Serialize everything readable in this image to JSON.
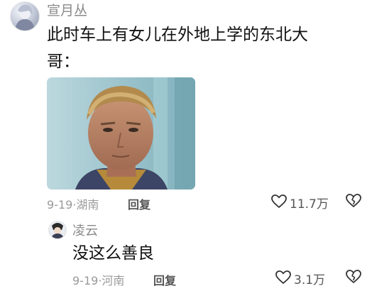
{
  "comments": [
    {
      "username": "宣月丛",
      "text_line1": "此时车上有女儿在外地上学的东北大",
      "text_line2": "哥：",
      "date": "9-19",
      "sep": "·",
      "location": "湖南",
      "reply_label": "回复",
      "like_count": "11.7万",
      "image_icon": "photo-portrait"
    },
    {
      "username": "凌云",
      "text": "没这么善良",
      "date": "9-19",
      "sep": "·",
      "location": "河南",
      "reply_label": "回复",
      "like_count": "3.1万"
    }
  ],
  "icons": {
    "like": "heart-outline-icon",
    "dislike": "broken-heart-icon"
  },
  "colors": {
    "text": "#111111",
    "meta": "#9a9a9a",
    "icon": "#333333"
  }
}
